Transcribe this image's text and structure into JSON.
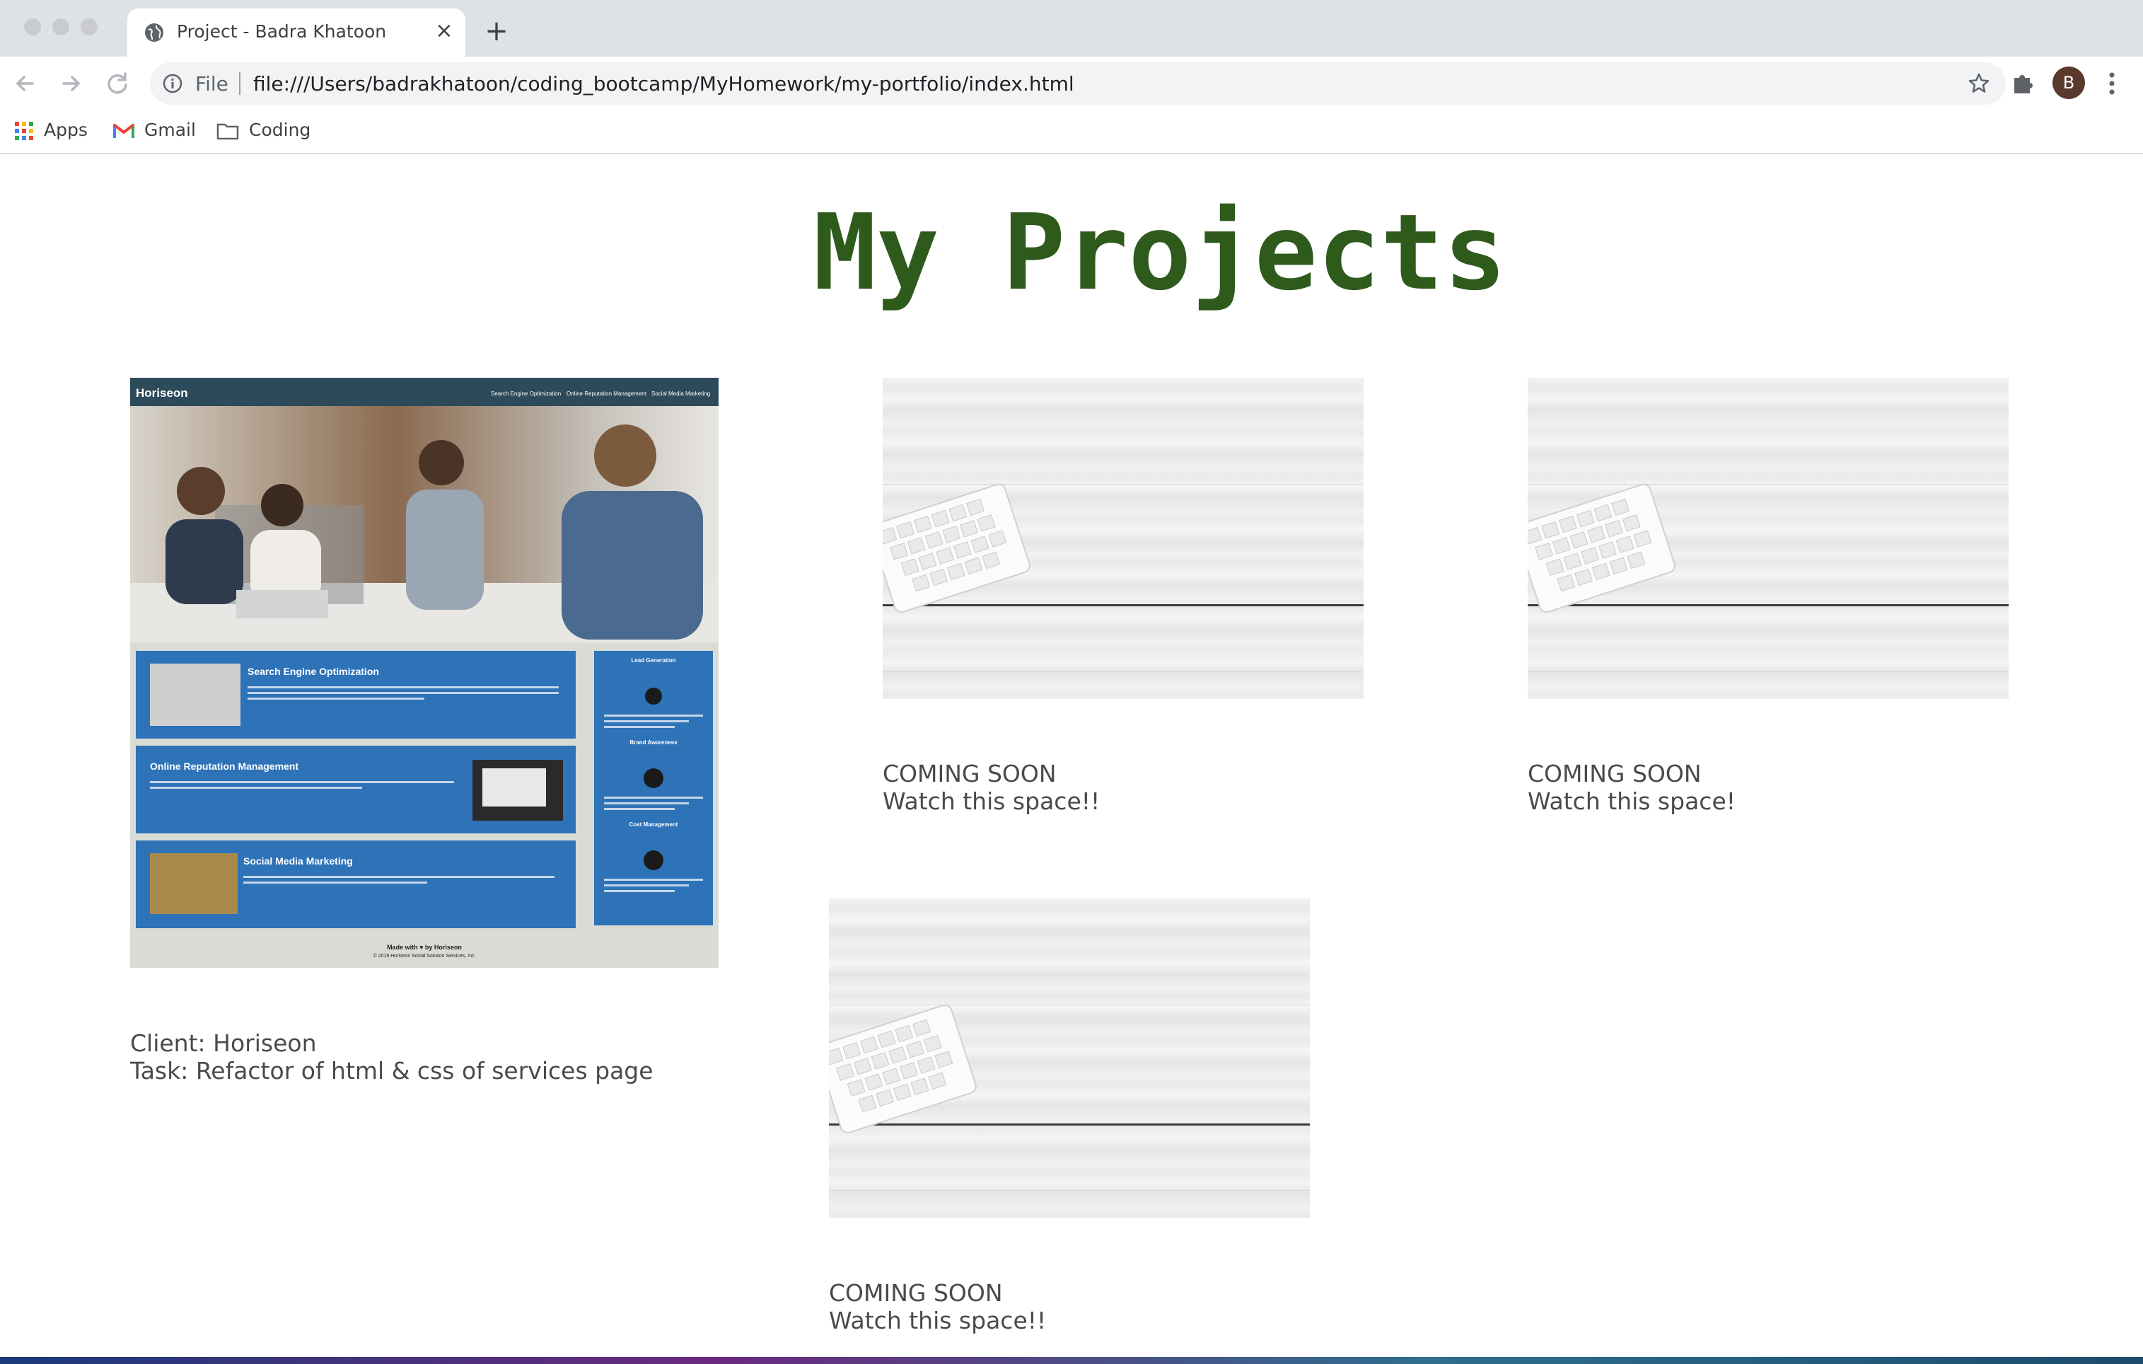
{
  "browser": {
    "tab_title": "Project - Badra Khatoon",
    "scheme_label": "File",
    "url": "file:///Users/badrakhatoon/coding_bootcamp/MyHomework/my-portfolio/index.html",
    "profile_initial": "B",
    "bookmarks": [
      {
        "label": "Apps",
        "icon": "apps-grid-icon"
      },
      {
        "label": "Gmail",
        "icon": "gmail-icon"
      },
      {
        "label": "Coding",
        "icon": "folder-icon"
      }
    ]
  },
  "page": {
    "title": "My Projects",
    "colors": {
      "title": "#2e5a1c",
      "text": "#4a4a4a"
    },
    "projects": [
      {
        "line1": "Client: Horiseon",
        "line2": "Task: Refactor of html & css of services page"
      },
      {
        "line1": "COMING SOON",
        "line2": "Watch this space!!"
      },
      {
        "line1": "COMING SOON",
        "line2": "Watch this space!"
      },
      {
        "line1": "COMING SOON",
        "line2": "Watch this space!!"
      }
    ]
  },
  "horiseon": {
    "brand": "Horiseon",
    "nav": [
      "Search Engine Optimization",
      "Online Reputation Management",
      "Social Media Marketing"
    ],
    "sections": [
      "Search Engine Optimization",
      "Online Reputation Management",
      "Social Media Marketing"
    ],
    "side": [
      "Lead Generation",
      "Brand Awareness",
      "Cost Management"
    ],
    "footer": "Made with ♥ by Horiseon",
    "copyright": "© 2019 Horiseon Social Solution Services, Inc."
  }
}
